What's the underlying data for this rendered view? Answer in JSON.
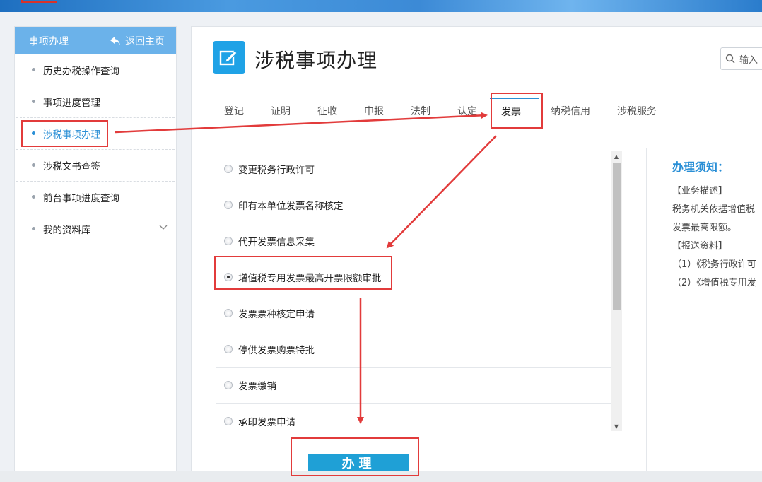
{
  "sidebar": {
    "header_title": "事项办理",
    "back_label": "返回主页",
    "items": [
      {
        "label": "历史办税操作查询",
        "active": false
      },
      {
        "label": "事项进度管理",
        "active": false
      },
      {
        "label": "涉税事项办理",
        "active": true
      },
      {
        "label": "涉税文书查签",
        "active": false
      },
      {
        "label": "前台事项进度查询",
        "active": false
      },
      {
        "label": "我的资料库",
        "active": false,
        "expandable": true
      }
    ]
  },
  "main": {
    "title": "涉税事项办理",
    "search_placeholder": "输入",
    "tabs": [
      {
        "label": "登记"
      },
      {
        "label": "证明"
      },
      {
        "label": "征收"
      },
      {
        "label": "申报"
      },
      {
        "label": "法制"
      },
      {
        "label": "认定"
      },
      {
        "label": "发票",
        "active": true
      },
      {
        "label": "纳税信用"
      },
      {
        "label": "涉税服务"
      }
    ],
    "list_items": [
      {
        "label": "变更税务行政许可",
        "selected": false
      },
      {
        "label": "印有本单位发票名称核定",
        "selected": false
      },
      {
        "label": "代开发票信息采集",
        "selected": false
      },
      {
        "label": "增值税专用发票最高开票限额审批",
        "selected": true
      },
      {
        "label": "发票票种核定申请",
        "selected": false
      },
      {
        "label": "停供发票购票特批",
        "selected": false
      },
      {
        "label": "发票缴销",
        "selected": false
      },
      {
        "label": "承印发票申请",
        "selected": false
      }
    ],
    "notice": {
      "title": "办理须知：",
      "lines": [
        "【业务描述】",
        "税务机关依据增值税",
        "发票最高限额。",
        "【报送资料】",
        "（1）《税务行政许可",
        "（2）《增值税专用发"
      ]
    },
    "submit_label": "办理"
  },
  "colors": {
    "accent": "#2a8fd6",
    "sidebar_header": "#6bb2ea",
    "button": "#1fa0d6",
    "annotation": "#e23b3b"
  }
}
